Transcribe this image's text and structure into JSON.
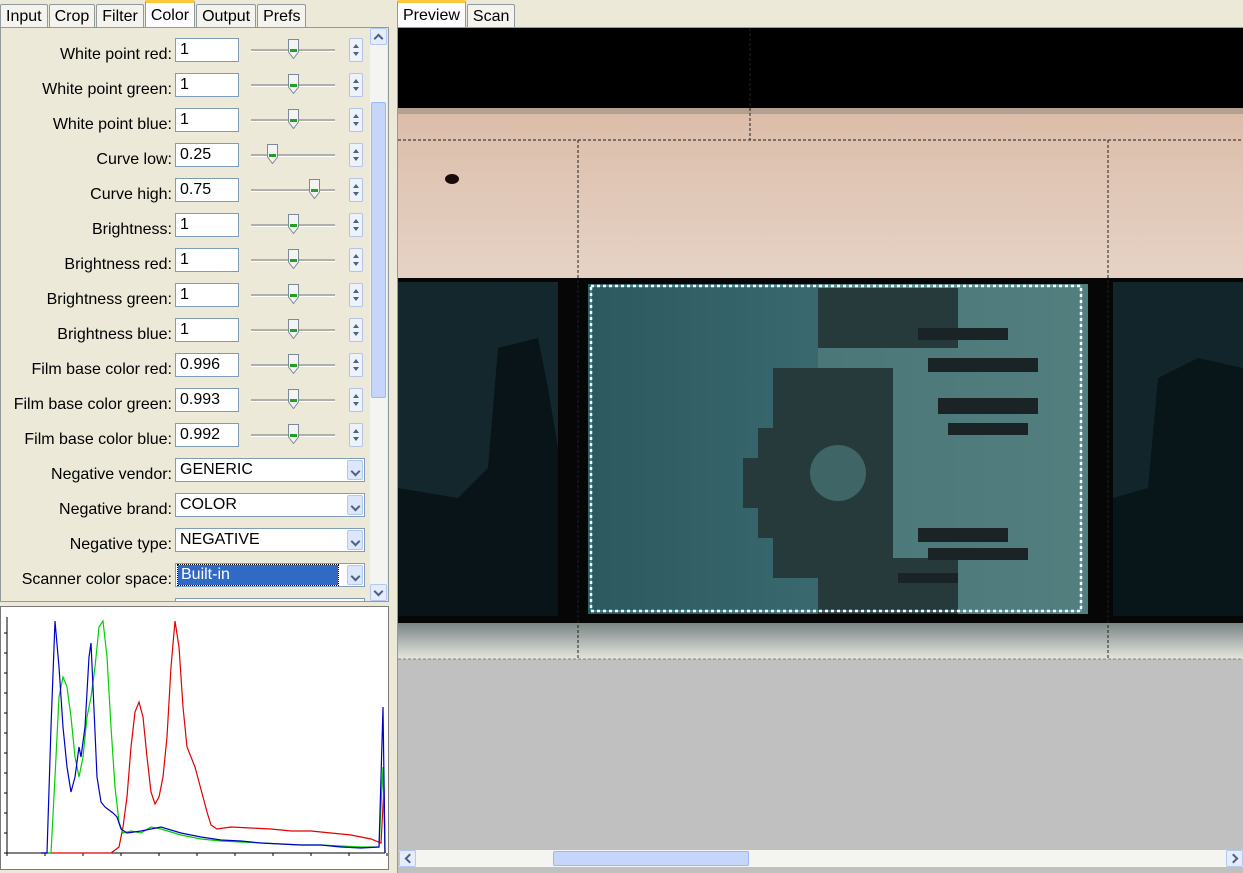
{
  "left_tabs": [
    "Input",
    "Crop",
    "Filter",
    "Color",
    "Output",
    "Prefs"
  ],
  "right_tabs": [
    "Preview",
    "Scan"
  ],
  "settings": [
    {
      "label": "White point red:",
      "value": "1",
      "slider": 0.5
    },
    {
      "label": "White point green:",
      "value": "1",
      "slider": 0.5
    },
    {
      "label": "White point blue:",
      "value": "1",
      "slider": 0.5
    },
    {
      "label": "Curve low:",
      "value": "0.25",
      "slider": 0.25
    },
    {
      "label": "Curve high:",
      "value": "0.75",
      "slider": 0.75
    },
    {
      "label": "Brightness:",
      "value": "1",
      "slider": 0.5
    },
    {
      "label": "Brightness red:",
      "value": "1",
      "slider": 0.5
    },
    {
      "label": "Brightness green:",
      "value": "1",
      "slider": 0.5
    },
    {
      "label": "Brightness blue:",
      "value": "1",
      "slider": 0.5
    },
    {
      "label": "Film base color red:",
      "value": "0.996",
      "slider": 0.5
    },
    {
      "label": "Film base color green:",
      "value": "0.993",
      "slider": 0.5
    },
    {
      "label": "Film base color blue:",
      "value": "0.992",
      "slider": 0.5
    }
  ],
  "dropdowns": [
    {
      "label": "Negative vendor:",
      "value": "GENERIC"
    },
    {
      "label": "Negative brand:",
      "value": "COLOR"
    },
    {
      "label": "Negative type:",
      "value": "NEGATIVE"
    },
    {
      "label": "Scanner color space:",
      "value": "Built-in",
      "selected": true
    }
  ],
  "colors": {
    "tab_highlight": "#ffc83c",
    "histogram_red": "#e00000",
    "histogram_green": "#00d000",
    "histogram_blue": "#0000c8",
    "selection_blue": "#316ac5"
  }
}
